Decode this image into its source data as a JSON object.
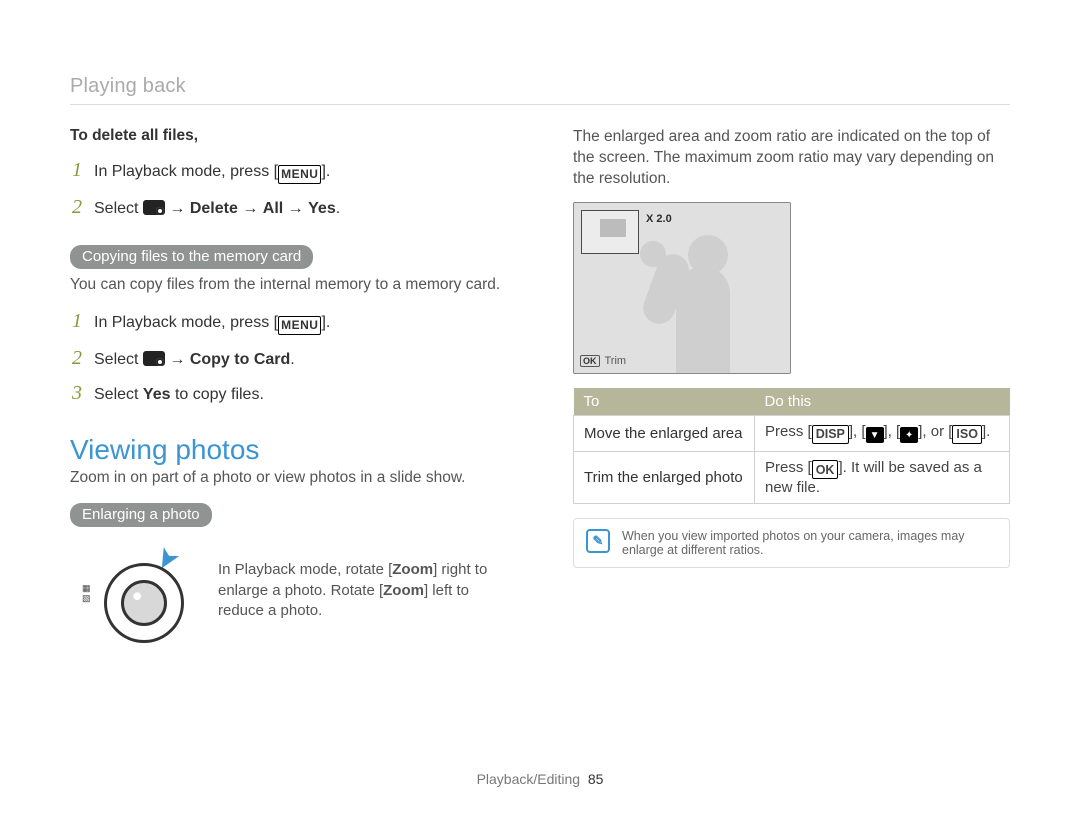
{
  "breadcrumb": "Playing back",
  "left": {
    "delete_heading": "To delete all files,",
    "delete_steps": {
      "s1_pre": "In Playback mode, press [",
      "s1_key": "MENU",
      "s1_post": "].",
      "s2_pre": "Select ",
      "s2_arrow": " → ",
      "s2_b1": "Delete",
      "s2_b2": "All",
      "s2_b3": "Yes",
      "s2_post": "."
    },
    "copy_pill": "Copying files to the memory card",
    "copy_desc": "You can copy files from the internal memory to a memory card.",
    "copy_steps": {
      "s1_pre": "In Playback mode, press [",
      "s1_key": "MENU",
      "s1_post": "].",
      "s2_pre": "Select ",
      "s2_arrow": " → ",
      "s2_b1": "Copy to Card",
      "s2_post": ".",
      "s3_pre": "Select ",
      "s3_b1": "Yes",
      "s3_post": " to copy files."
    },
    "section_title": "Viewing photos",
    "section_desc": "Zoom in on part of a photo or view photos in a slide show.",
    "enlarge_pill": "Enlarging a photo",
    "enlarge_text_pre": "In Playback mode, rotate [",
    "enlarge_text_b1": "Zoom",
    "enlarge_text_mid": "] right to enlarge a photo. Rotate [",
    "enlarge_text_b2": "Zoom",
    "enlarge_text_post": "] left to reduce a photo."
  },
  "right": {
    "intro": "The enlarged area and zoom ratio are indicated on the top of the screen. The maximum zoom ratio may vary depending on the resolution.",
    "zoom_label": "X 2.0",
    "trim_label": "Trim",
    "table": {
      "head1": "To",
      "head2": "Do this",
      "r1c1": "Move the enlarged area",
      "r1c2_pre": "Press [",
      "r1c2_k1": "DISP",
      "r1c2_mid1": "], [",
      "r1c2_mid2": "], [",
      "r1c2_mid3": "], or [",
      "r1c2_k4": "ISO",
      "r1c2_post": "].",
      "r2c1": "Trim the enlarged photo",
      "r2c2_pre": "Press [",
      "r2c2_k1": "OK",
      "r2c2_post": "]. It will be saved as a new file."
    },
    "note": "When you view imported photos on your camera, images may enlarge at different ratios."
  },
  "footer": {
    "section": "Playback/Editing",
    "page": "85"
  }
}
